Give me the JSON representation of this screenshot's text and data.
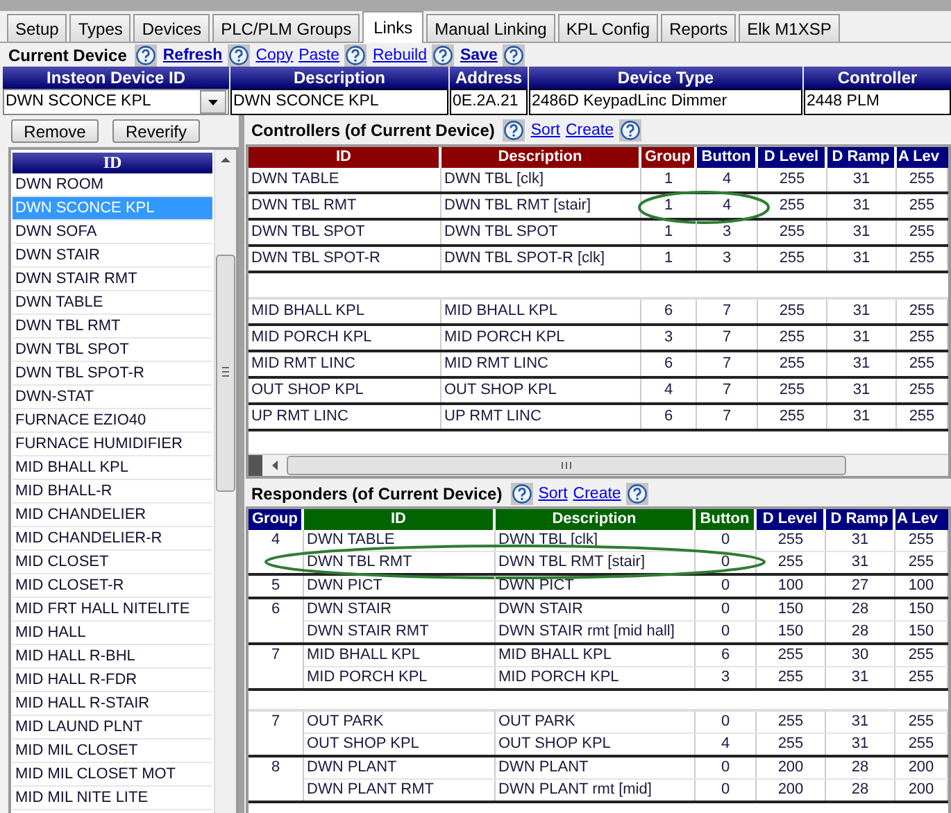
{
  "tabs": [
    {
      "label": "Setup",
      "selected": false
    },
    {
      "label": "Types",
      "selected": false
    },
    {
      "label": "Devices",
      "selected": false
    },
    {
      "label": "PLC/PLM Groups",
      "selected": false
    },
    {
      "label": "Links",
      "selected": true
    },
    {
      "label": "Manual Linking",
      "selected": false
    },
    {
      "label": "KPL Config",
      "selected": false
    },
    {
      "label": "Reports",
      "selected": false
    },
    {
      "label": "Elk M1XSP",
      "selected": false
    }
  ],
  "current_device": {
    "toolbar": [
      {
        "kind": "title",
        "text": "Current Device"
      },
      {
        "kind": "help"
      },
      {
        "kind": "link",
        "text": "Refresh",
        "bold": true
      },
      {
        "kind": "help"
      },
      {
        "kind": "link",
        "text": "Copy",
        "bold": false
      },
      {
        "kind": "link",
        "text": "Paste",
        "bold": false
      },
      {
        "kind": "help"
      },
      {
        "kind": "link",
        "text": "Rebuild",
        "bold": false
      },
      {
        "kind": "help"
      },
      {
        "kind": "link",
        "text": "Save",
        "bold": true
      },
      {
        "kind": "help"
      }
    ],
    "columns": [
      "Insteon Device ID",
      "Description",
      "Address",
      "Device Type",
      "Controller"
    ],
    "values": [
      "DWN SCONCE KPL",
      "DWN SCONCE KPL",
      "0E.2A.21",
      "2486D KeypadLinc Dimmer",
      "2448 PLM"
    ]
  },
  "buttons": [
    "Remove",
    "Reverify"
  ],
  "device_list": {
    "column": "ID",
    "items": [
      {
        "label": "DWN ROOM",
        "selected": false
      },
      {
        "label": "DWN SCONCE KPL",
        "selected": true
      },
      {
        "label": "DWN SOFA",
        "selected": false
      },
      {
        "label": "DWN STAIR",
        "selected": false
      },
      {
        "label": "DWN STAIR RMT",
        "selected": false
      },
      {
        "label": "DWN TABLE",
        "selected": false
      },
      {
        "label": "DWN TBL RMT",
        "selected": false
      },
      {
        "label": "DWN TBL SPOT",
        "selected": false
      },
      {
        "label": "DWN TBL SPOT-R",
        "selected": false
      },
      {
        "label": "DWN-STAT",
        "selected": false
      },
      {
        "label": "FURNACE EZIO40",
        "selected": false
      },
      {
        "label": "FURNACE HUMIDIFIER",
        "selected": false
      },
      {
        "label": "MID BHALL KPL",
        "selected": false
      },
      {
        "label": "MID BHALL-R",
        "selected": false
      },
      {
        "label": "MID CHANDELIER",
        "selected": false
      },
      {
        "label": "MID CHANDELIER-R",
        "selected": false
      },
      {
        "label": "MID CLOSET",
        "selected": false
      },
      {
        "label": "MID CLOSET-R",
        "selected": false
      },
      {
        "label": "MID FRT HALL NITELITE",
        "selected": false
      },
      {
        "label": "MID HALL",
        "selected": false
      },
      {
        "label": "MID HALL R-BHL",
        "selected": false
      },
      {
        "label": "MID HALL R-FDR",
        "selected": false
      },
      {
        "label": "MID HALL R-STAIR",
        "selected": false
      },
      {
        "label": "MID LAUND PLNT",
        "selected": false
      },
      {
        "label": "MID MIL CLOSET",
        "selected": false
      },
      {
        "label": "MID MIL CLOSET MOT",
        "selected": false
      },
      {
        "label": "MID MIL NITE LITE",
        "selected": false
      }
    ]
  },
  "controllers": {
    "toolbar": [
      {
        "kind": "title",
        "text": "Controllers (of Current Device)"
      },
      {
        "kind": "help"
      },
      {
        "kind": "link",
        "text": "Sort",
        "bold": false
      },
      {
        "kind": "link",
        "text": "Create",
        "bold": false
      },
      {
        "kind": "help"
      }
    ],
    "columns": [
      {
        "label": "ID",
        "color": "#8b0000",
        "kind": "text"
      },
      {
        "label": "Description",
        "color": "#8b0000",
        "kind": "text"
      },
      {
        "label": "Group",
        "color": "#8b0000",
        "kind": "number"
      },
      {
        "label": "Button",
        "color": "#000080",
        "kind": "number"
      },
      {
        "label": "D Level",
        "color": "#000080",
        "kind": "number"
      },
      {
        "label": "D Ramp",
        "color": "#000080",
        "kind": "number"
      },
      {
        "label": "A Lev",
        "color": "#000080",
        "kind": "number"
      }
    ],
    "sections": [
      {
        "rows": [
          {
            "cells": [
              "DWN TABLE",
              "DWN TBL [clk]",
              "1",
              "4",
              "255",
              "31",
              "255"
            ],
            "circled": false
          },
          {
            "cells": [
              "DWN TBL RMT",
              "DWN TBL RMT [stair]",
              "1",
              "4",
              "255",
              "31",
              "255"
            ],
            "circled": true
          },
          {
            "cells": [
              "DWN TBL SPOT",
              "DWN TBL SPOT",
              "1",
              "3",
              "255",
              "31",
              "255"
            ],
            "circled": false
          },
          {
            "cells": [
              "DWN TBL SPOT-R",
              "DWN TBL SPOT-R [clk]",
              "1",
              "3",
              "255",
              "31",
              "255"
            ],
            "circled": false
          }
        ]
      },
      {
        "rows": [
          {
            "cells": [
              "MID BHALL KPL",
              "MID BHALL KPL",
              "6",
              "7",
              "255",
              "31",
              "255"
            ],
            "circled": false
          },
          {
            "cells": [
              "MID PORCH KPL",
              "MID PORCH KPL",
              "3",
              "7",
              "255",
              "31",
              "255"
            ],
            "circled": false
          },
          {
            "cells": [
              "MID RMT LINC",
              "MID RMT LINC",
              "6",
              "7",
              "255",
              "31",
              "255"
            ],
            "circled": false
          },
          {
            "cells": [
              "OUT SHOP KPL",
              "OUT SHOP KPL",
              "4",
              "7",
              "255",
              "31",
              "255"
            ],
            "circled": false
          },
          {
            "cells": [
              "UP RMT LINC",
              "UP RMT LINC",
              "6",
              "7",
              "255",
              "31",
              "255"
            ],
            "circled": false
          }
        ]
      }
    ]
  },
  "responders": {
    "toolbar": [
      {
        "kind": "title",
        "text": "Responders (of Current Device)"
      },
      {
        "kind": "help"
      },
      {
        "kind": "link",
        "text": "Sort",
        "bold": false
      },
      {
        "kind": "link",
        "text": "Create",
        "bold": false
      },
      {
        "kind": "help"
      }
    ],
    "columns": [
      {
        "label": "Group",
        "color": "#000080",
        "kind": "number"
      },
      {
        "label": "ID",
        "color": "#006400",
        "kind": "text"
      },
      {
        "label": "Description",
        "color": "#006400",
        "kind": "text"
      },
      {
        "label": "Button",
        "color": "#006400",
        "kind": "number"
      },
      {
        "label": "D Level",
        "color": "#000080",
        "kind": "number"
      },
      {
        "label": "D Ramp",
        "color": "#000080",
        "kind": "number"
      },
      {
        "label": "A Lev",
        "color": "#000080",
        "kind": "number"
      }
    ],
    "sections": [
      {
        "groups": [
          {
            "group": "4",
            "rows": [
              {
                "cells": [
                  "DWN TABLE",
                  "DWN TBL [clk]",
                  "0",
                  "255",
                  "31",
                  "255"
                ],
                "circled": false
              },
              {
                "cells": [
                  "DWN TBL RMT",
                  "DWN TBL RMT [stair]",
                  "0",
                  "255",
                  "31",
                  "255"
                ],
                "circled": true
              }
            ]
          },
          {
            "group": "5",
            "rows": [
              {
                "cells": [
                  "DWN PICT",
                  "DWN PICT",
                  "0",
                  "100",
                  "27",
                  "100"
                ],
                "circled": false
              }
            ]
          },
          {
            "group": "6",
            "rows": [
              {
                "cells": [
                  "DWN STAIR",
                  "DWN STAIR",
                  "0",
                  "150",
                  "28",
                  "150"
                ],
                "circled": false
              },
              {
                "cells": [
                  "DWN STAIR RMT",
                  "DWN STAIR rmt [mid hall]",
                  "0",
                  "150",
                  "28",
                  "150"
                ],
                "circled": false
              }
            ]
          },
          {
            "group": "7",
            "rows": [
              {
                "cells": [
                  "MID BHALL KPL",
                  "MID BHALL KPL",
                  "6",
                  "255",
                  "30",
                  "255"
                ],
                "circled": false
              },
              {
                "cells": [
                  "MID PORCH KPL",
                  "MID PORCH KPL",
                  "3",
                  "255",
                  "31",
                  "255"
                ],
                "circled": false
              }
            ]
          }
        ]
      },
      {
        "groups": [
          {
            "group": "7",
            "rows": [
              {
                "cells": [
                  "OUT PARK",
                  "OUT PARK",
                  "0",
                  "255",
                  "31",
                  "255"
                ],
                "circled": false
              },
              {
                "cells": [
                  "OUT SHOP KPL",
                  "OUT SHOP KPL",
                  "4",
                  "255",
                  "31",
                  "255"
                ],
                "circled": false
              }
            ]
          },
          {
            "group": "8",
            "rows": [
              {
                "cells": [
                  "DWN PLANT",
                  "DWN PLANT",
                  "0",
                  "200",
                  "28",
                  "200"
                ],
                "circled": false
              },
              {
                "cells": [
                  "DWN PLANT RMT",
                  "DWN PLANT rmt [mid]",
                  "0",
                  "200",
                  "28",
                  "200"
                ],
                "circled": false
              }
            ]
          }
        ]
      }
    ]
  }
}
